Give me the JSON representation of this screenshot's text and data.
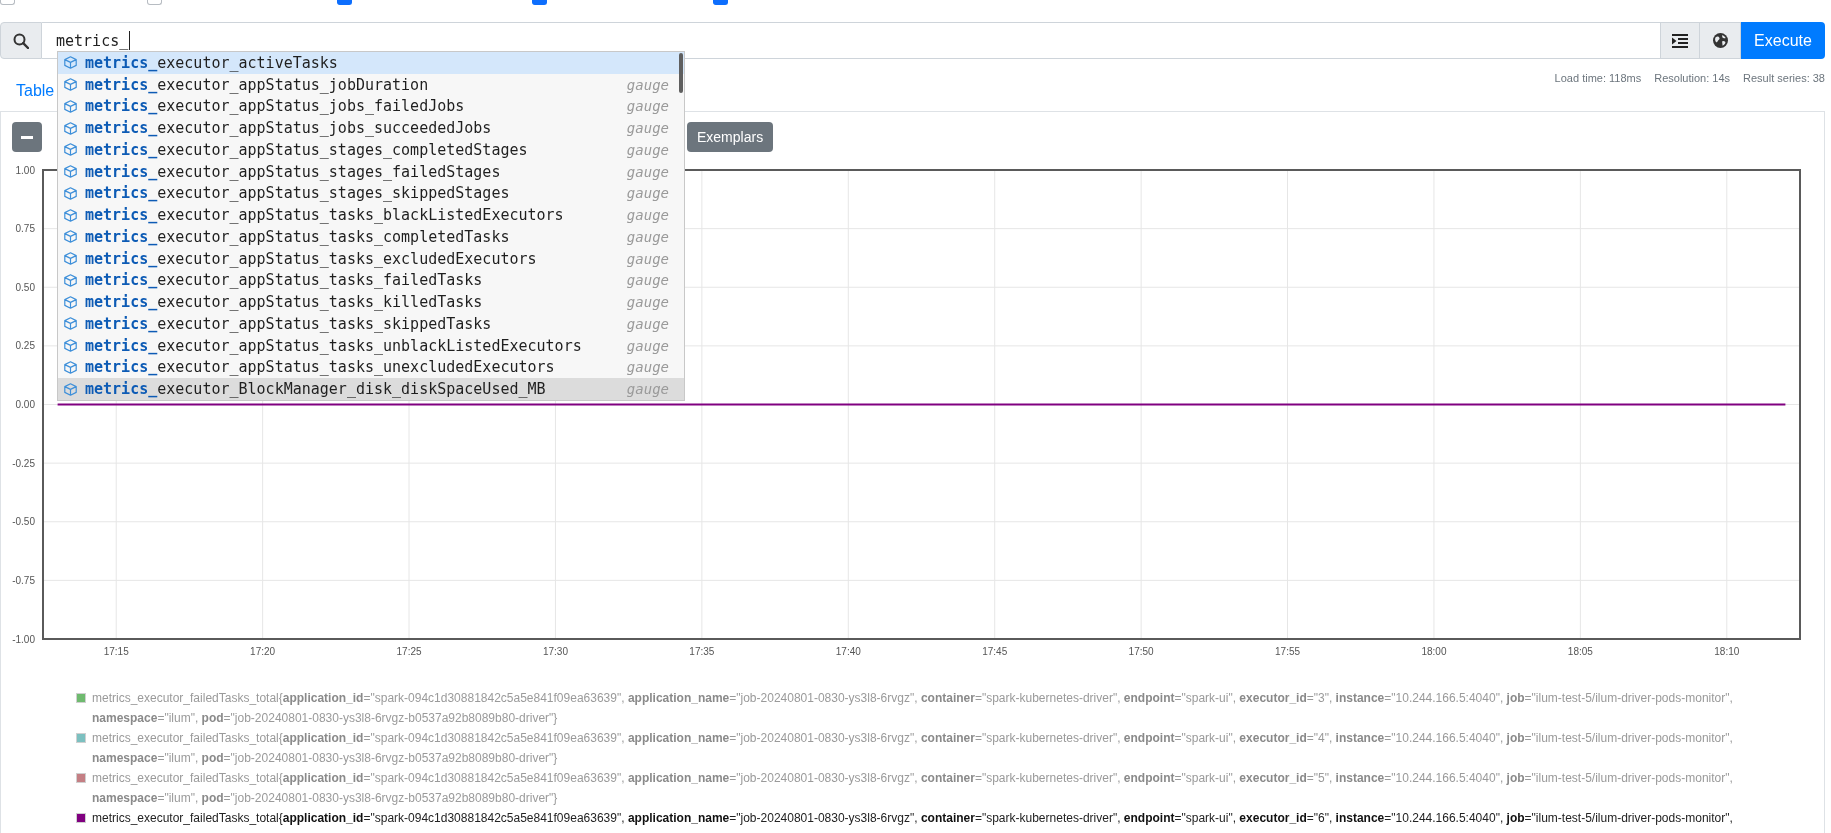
{
  "top_options": [
    {
      "checked": false
    },
    {
      "checked": false
    },
    {
      "checked": true
    },
    {
      "checked": true
    },
    {
      "checked": true
    }
  ],
  "query": {
    "value": "metrics_"
  },
  "query_buttons": [
    {
      "kind": "format"
    },
    {
      "kind": "explorer"
    },
    {
      "kind": "execute",
      "label": "Execute"
    }
  ],
  "autocomplete": [
    {
      "label": "**metrics_**executor_activeTasks",
      "selected": true,
      "hovered": false
    },
    {
      "label": "**metrics_**executor_appStatus_jobDuration",
      "type": "gauge",
      "selected": false,
      "hovered": false
    },
    {
      "label": "**metrics_**executor_appStatus_jobs_failedJobs",
      "type": "gauge",
      "selected": false,
      "hovered": false
    },
    {
      "label": "**metrics_**executor_appStatus_jobs_succeededJobs",
      "type": "gauge",
      "selected": false,
      "hovered": false
    },
    {
      "label": "**metrics_**executor_appStatus_stages_completedStages",
      "type": "gauge",
      "selected": false,
      "hovered": false
    },
    {
      "label": "**metrics_**executor_appStatus_stages_failedStages",
      "type": "gauge",
      "selected": false,
      "hovered": false
    },
    {
      "label": "**metrics_**executor_appStatus_stages_skippedStages",
      "type": "gauge",
      "selected": false,
      "hovered": false
    },
    {
      "label": "**metrics_**executor_appStatus_tasks_blackListedExecutors",
      "type": "gauge",
      "selected": false,
      "hovered": false
    },
    {
      "label": "**metrics_**executor_appStatus_tasks_completedTasks",
      "type": "gauge",
      "selected": false,
      "hovered": false
    },
    {
      "label": "**metrics_**executor_appStatus_tasks_excludedExecutors",
      "type": "gauge",
      "selected": false,
      "hovered": false
    },
    {
      "label": "**metrics_**executor_appStatus_tasks_failedTasks",
      "type": "gauge",
      "selected": false,
      "hovered": false
    },
    {
      "label": "**metrics_**executor_appStatus_tasks_killedTasks",
      "type": "gauge",
      "selected": false,
      "hovered": false
    },
    {
      "label": "**metrics_**executor_appStatus_tasks_skippedTasks",
      "type": "gauge",
      "selected": false,
      "hovered": false
    },
    {
      "label": "**metrics_**executor_appStatus_tasks_unblackListedExecutors",
      "type": "gauge",
      "selected": false,
      "hovered": false
    },
    {
      "label": "**metrics_**executor_appStatus_tasks_unexcludedExecutors",
      "type": "gauge",
      "selected": false,
      "hovered": false
    },
    {
      "label": "**metrics_**executor_BlockManager_disk_diskSpaceUsed_MB",
      "type": "gauge",
      "selected": false,
      "hovered": true
    }
  ],
  "tabs": [
    {
      "label": "Table",
      "selected": false
    }
  ],
  "stats": [
    "Load time: 118ms",
    "Resolution: 14s",
    "Result series: 38"
  ],
  "graph": {
    "toolbar": [
      {
        "kind": "minus"
      },
      {
        "kind": "exemplars",
        "label": "Exemplars"
      }
    ],
    "chart_data": {
      "type": "line",
      "grid": true,
      "categories": [
        null,
        null,
        "17:15",
        null,
        null,
        null,
        null,
        "17:20",
        null,
        null,
        null,
        null,
        "17:25",
        null,
        null,
        null,
        null,
        "17:30",
        null,
        null,
        null,
        null,
        "17:35",
        null,
        null,
        null,
        null,
        "17:40",
        null,
        null,
        null,
        null,
        "17:45",
        null,
        null,
        null,
        null,
        "17:50",
        null,
        null,
        null,
        null,
        "17:55",
        null,
        null,
        null,
        null,
        "18:00",
        null,
        null,
        null,
        null,
        "18:05",
        null,
        null,
        null,
        null,
        "18:10",
        null,
        null
      ],
      "ylim": [
        -1,
        1
      ],
      "yticks": [
        {
          "value": 1,
          "label": "1.00"
        },
        {
          "value": 0.75,
          "label": "0.75"
        },
        {
          "value": 0.5,
          "label": "0.50"
        },
        {
          "value": 0.25,
          "label": "0.25"
        },
        {
          "value": 0,
          "label": "0.00"
        },
        {
          "value": -0.25,
          "label": "-0.25"
        },
        {
          "value": -0.5,
          "label": "-0.50"
        },
        {
          "value": -0.75,
          "label": "-0.75"
        },
        {
          "value": -1,
          "label": "-1.00"
        }
      ],
      "series": [
        {
          "color": "#800080",
          "values": [
            0,
            0,
            0,
            0,
            0,
            0,
            0,
            0,
            0,
            0,
            0,
            0,
            0,
            0,
            0,
            0,
            0,
            0,
            0,
            0,
            0,
            0,
            0,
            0,
            0,
            0,
            0,
            0,
            0,
            0,
            0,
            0,
            0,
            0,
            0,
            0,
            0,
            0,
            0,
            0,
            0,
            0,
            0,
            0,
            0,
            0,
            0,
            0,
            0,
            0,
            0,
            0,
            0,
            0,
            0,
            0,
            0,
            0,
            0,
            0
          ]
        }
      ]
    },
    "legend": [
      {
        "color": "#6fba6f",
        "label": "metrics_executor_failedTasks_total{**application_id**=\"spark-094c1d30881842c5a5e841f09ea63639\", **application_name**=\"job-20240801-0830-ys3l8-6rvgz\", **container**=\"spark-kubernetes-driver\", **endpoint**=\"spark-ui\", **executor_id**=\"3\", **instance**=\"10.244.166.5:4040\", **job**=\"ilum-test-5/ilum-driver-pods-monitor\", **namespace**=\"ilum\", **pod**=\"job-20240801-0830-ys3l8-6rvgz-b0537a92b8089b80-driver\"}",
        "selected": false
      },
      {
        "color": "#7cc0c0",
        "label": "metrics_executor_failedTasks_total{**application_id**=\"spark-094c1d30881842c5a5e841f09ea63639\", **application_name**=\"job-20240801-0830-ys3l8-6rvgz\", **container**=\"spark-kubernetes-driver\", **endpoint**=\"spark-ui\", **executor_id**=\"4\", **instance**=\"10.244.166.5:4040\", **job**=\"ilum-test-5/ilum-driver-pods-monitor\", **namespace**=\"ilum\", **pod**=\"job-20240801-0830-ys3l8-6rvgz-b0537a92b8089b80-driver\"}",
        "selected": false
      },
      {
        "color": "#c47f84",
        "label": "metrics_executor_failedTasks_total{**application_id**=\"spark-094c1d30881842c5a5e841f09ea63639\", **application_name**=\"job-20240801-0830-ys3l8-6rvgz\", **container**=\"spark-kubernetes-driver\", **endpoint**=\"spark-ui\", **executor_id**=\"5\", **instance**=\"10.244.166.5:4040\", **job**=\"ilum-test-5/ilum-driver-pods-monitor\", **namespace**=\"ilum\", **pod**=\"job-20240801-0830-ys3l8-6rvgz-b0537a92b8089b80-driver\"}",
        "selected": false
      },
      {
        "color": "#800080",
        "label": "metrics_executor_failedTasks_total{**application_id**=\"spark-094c1d30881842c5a5e841f09ea63639\", **application_name**=\"job-20240801-0830-ys3l8-6rvgz\", **container**=\"spark-kubernetes-driver\", **endpoint**=\"spark-ui\", **executor_id**=\"6\", **instance**=\"10.244.166.5:4040\", **job**=\"ilum-test-5/ilum-driver-pods-monitor\",",
        "selected": true
      }
    ]
  }
}
